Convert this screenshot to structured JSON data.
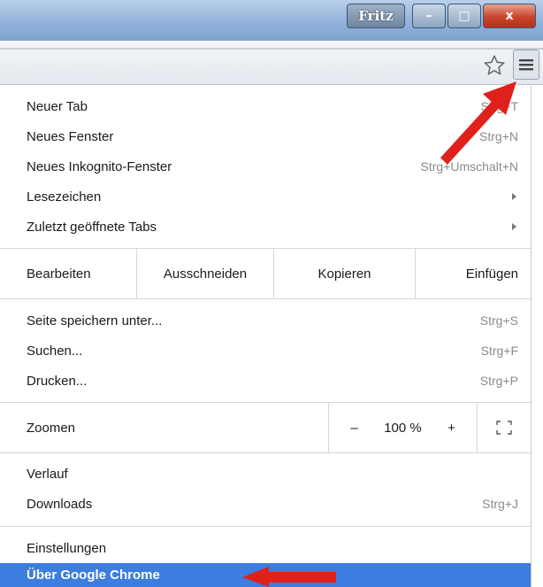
{
  "titlebar": {
    "user_label": "Fritz",
    "minimize_glyph": "–",
    "maximize_glyph": "□",
    "close_glyph": "x"
  },
  "toolbar": {
    "star_icon": "star-icon",
    "menu_icon": "hamburger-menu-icon"
  },
  "menu": {
    "new_tab": {
      "label": "Neuer Tab",
      "shortcut": "Strg+T"
    },
    "new_window": {
      "label": "Neues Fenster",
      "shortcut": "Strg+N"
    },
    "incognito": {
      "label": "Neues Inkognito-Fenster",
      "shortcut": "Strg+Umschalt+N"
    },
    "bookmarks": {
      "label": "Lesezeichen"
    },
    "recent_tabs": {
      "label": "Zuletzt geöffnete Tabs"
    },
    "edit": {
      "label": "Bearbeiten",
      "cut": "Ausschneiden",
      "copy": "Kopieren",
      "paste": "Einfügen"
    },
    "save_page": {
      "label": "Seite speichern unter...",
      "shortcut": "Strg+S"
    },
    "find": {
      "label": "Suchen...",
      "shortcut": "Strg+F"
    },
    "print": {
      "label": "Drucken...",
      "shortcut": "Strg+P"
    },
    "zoom": {
      "label": "Zoomen",
      "minus": "–",
      "value": "100 %",
      "plus": "+"
    },
    "history": {
      "label": "Verlauf"
    },
    "downloads": {
      "label": "Downloads",
      "shortcut": "Strg+J"
    },
    "settings": {
      "label": "Einstellungen"
    },
    "about": {
      "label": "Über Google Chrome"
    }
  },
  "colors": {
    "highlight": "#3d7de0",
    "annotation_arrow": "#e0201a"
  }
}
